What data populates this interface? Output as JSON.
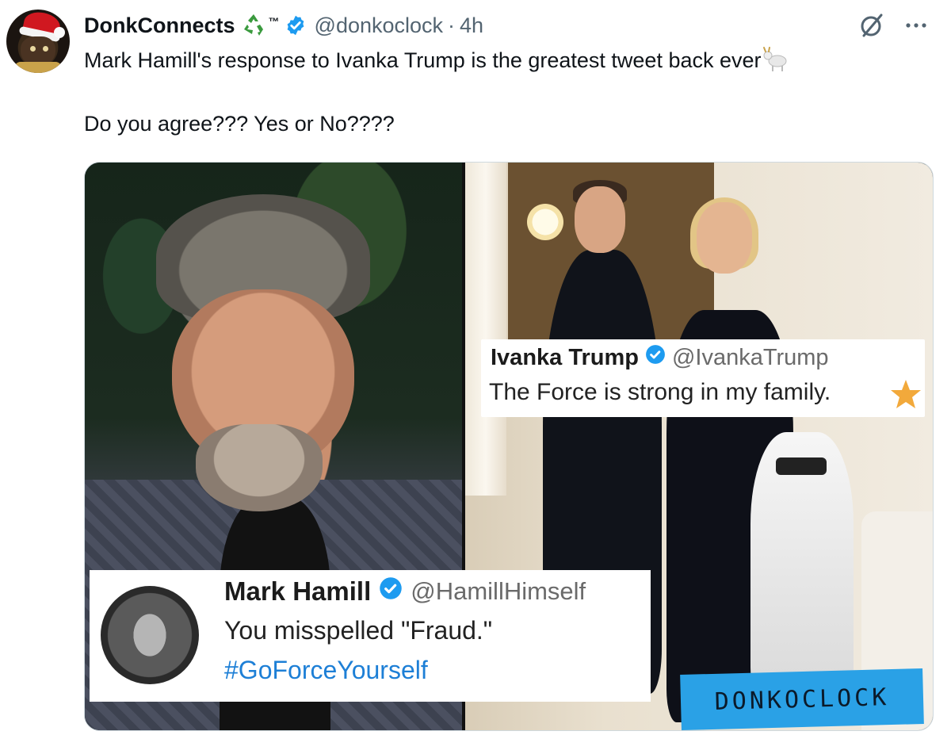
{
  "tweet": {
    "display_name": "DonkConnects",
    "name_suffix": "™",
    "handle": "@donkoclock",
    "separator": "·",
    "time": "4h",
    "text_line1": "Mark Hamill's response to Ivanka Trump is the greatest tweet back ever",
    "text_line2": "Do you agree??? Yes or No????",
    "icons": [
      "avatar",
      "recycle-icon",
      "verified-icon",
      "grok-icon",
      "more-icon",
      "goat-icon"
    ]
  },
  "media": {
    "ivanka_card": {
      "name": "Ivanka Trump",
      "handle": "@IvankaTrump",
      "text": "The Force is strong in my family."
    },
    "hamill_card": {
      "name": "Mark Hamill",
      "handle": "@HamillHimself",
      "text": "You misspelled \"Fraud.\"",
      "hashtag": "#GoForceYourself"
    },
    "watermark": "DONKOCLOCK"
  },
  "colors": {
    "verified": "#1d9bf0",
    "secondary_text": "#536471",
    "hashtag": "#1d7fd6",
    "watermark_bg": "#2aa1e6",
    "star": "#f2a93b"
  }
}
